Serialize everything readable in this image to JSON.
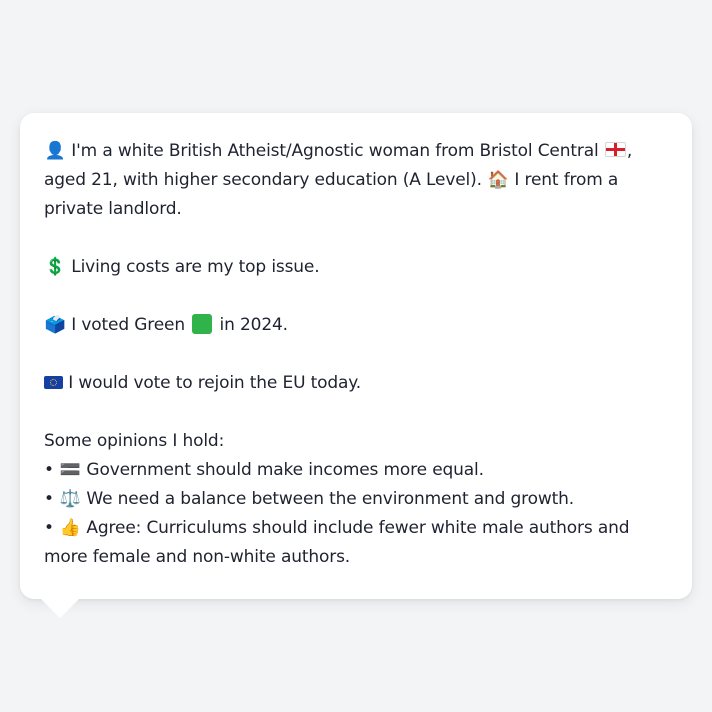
{
  "profile": {
    "intro_part1": "I'm a white British Atheist/Agnostic woman from Bristol Central",
    "intro_part2": ", aged 21, with higher secondary education (A Level).",
    "intro_part3": "I rent from a private landlord.",
    "top_issue": "Living costs are my top issue.",
    "vote_part1": "I voted Green",
    "vote_part2": "in 2024.",
    "eu": "I would vote to rejoin the EU today.",
    "opinions_heading": "Some opinions I hold:",
    "opinions": [
      {
        "bullet": "•",
        "icon": "🟰",
        "text": "Government should make incomes more equal."
      },
      {
        "bullet": "•",
        "icon": "⚖️",
        "text": "We need a balance between the environment and growth."
      },
      {
        "bullet": "•",
        "icon": "👍",
        "text": "Agree: Curriculums should include fewer white male authors and more female and non-white authors."
      }
    ]
  },
  "icons": {
    "person": "👤",
    "house": "🏠",
    "dollar": "💲",
    "ballot": "🗳️"
  },
  "colors": {
    "background": "#f3f4f6",
    "card": "#ffffff",
    "text": "#1f2330",
    "green_party": "#2fb34a",
    "eu_blue": "#153fa3"
  }
}
